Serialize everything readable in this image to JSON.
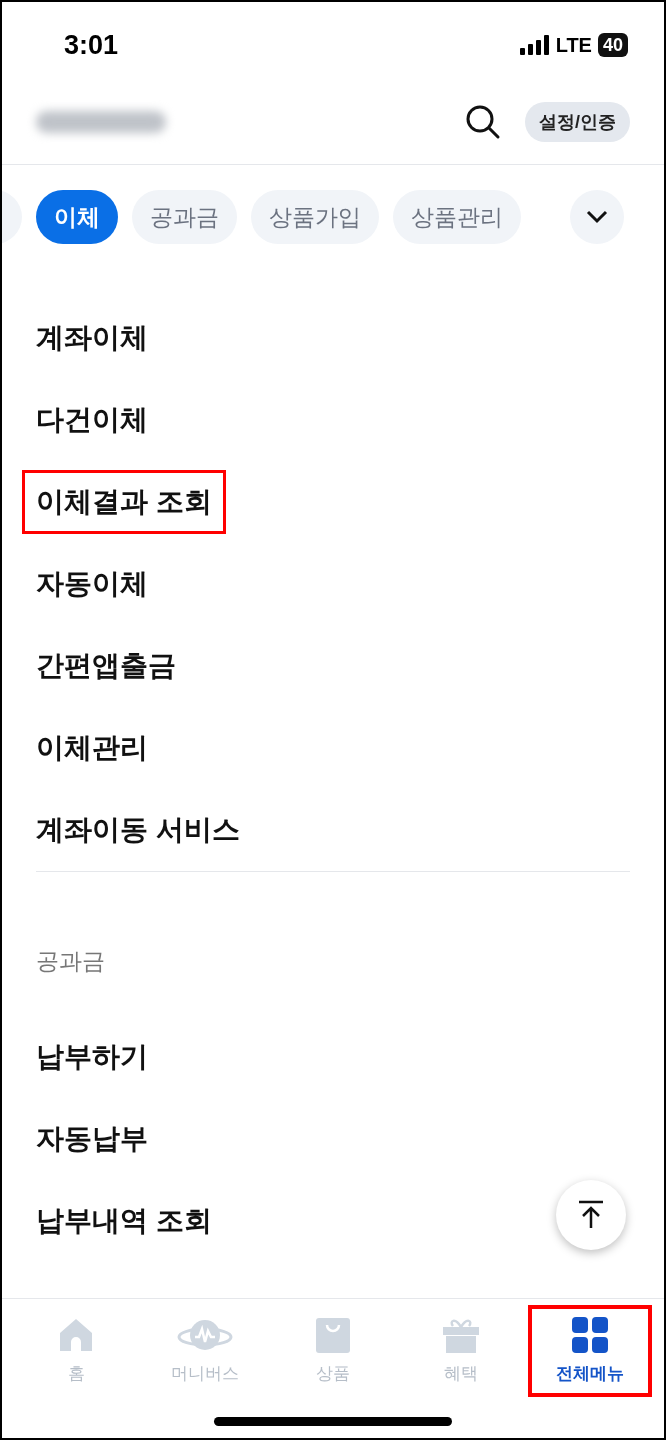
{
  "status_bar": {
    "time": "3:01",
    "network": "LTE",
    "battery": "40"
  },
  "header": {
    "settings_button": "설정/인증"
  },
  "chips": [
    {
      "selected": false
    },
    {
      "label": "이체",
      "selected": true
    },
    {
      "label": "공과금",
      "selected": false
    },
    {
      "label": "상품가입",
      "selected": false
    },
    {
      "label": "상품관리",
      "selected": false
    }
  ],
  "sections": [
    {
      "items": [
        {
          "label": "계좌이체",
          "highlighted": false
        },
        {
          "label": "다건이체",
          "highlighted": false
        },
        {
          "label": "이체결과 조회",
          "highlighted": true
        },
        {
          "label": "자동이체",
          "highlighted": false
        },
        {
          "label": "간편앱출금",
          "highlighted": false
        },
        {
          "label": "이체관리",
          "highlighted": false
        },
        {
          "label": "계좌이동 서비스",
          "highlighted": false
        }
      ]
    },
    {
      "title": "공과금",
      "items": [
        {
          "label": "납부하기",
          "highlighted": false
        },
        {
          "label": "자동납부",
          "highlighted": false
        },
        {
          "label": "납부내역 조회",
          "highlighted": false
        }
      ]
    }
  ],
  "bottom_nav": [
    {
      "kind": "home",
      "label": "홈",
      "selected": false,
      "highlighted": false
    },
    {
      "kind": "planet",
      "label": "머니버스",
      "selected": false,
      "highlighted": false
    },
    {
      "kind": "bag",
      "label": "상품",
      "selected": false,
      "highlighted": false
    },
    {
      "kind": "gift",
      "label": "혜택",
      "selected": false,
      "highlighted": false
    },
    {
      "kind": "grid",
      "label": "전체메뉴",
      "selected": true,
      "highlighted": true
    }
  ]
}
